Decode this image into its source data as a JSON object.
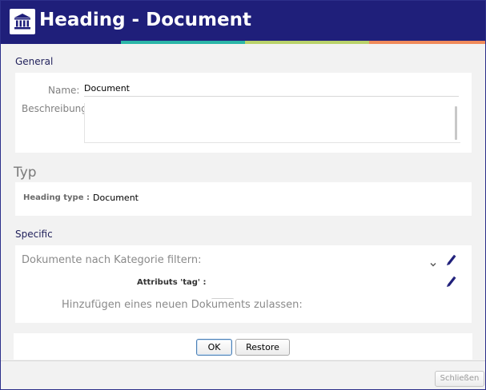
{
  "window": {
    "title": "Heading - Document",
    "icon": "building-columns-icon",
    "colors": {
      "titlebar": "#1f1f7a",
      "accent_stripes": [
        "#1f1f7a",
        "#2bb6a8",
        "#b9d26a",
        "#f08a5a"
      ]
    }
  },
  "general": {
    "section_label": "General",
    "name_label": "Name:",
    "name_value": "Document",
    "description_label": "Beschreibung:",
    "description_value": ""
  },
  "typ": {
    "heading": "Typ",
    "heading_type_label": "Heading type :",
    "heading_type_value": "Document"
  },
  "specific": {
    "section_label": "Specific",
    "filter_label": "Dokumente nach Kategorie filtern:",
    "filter_dropdown_icon": "chevron-down-icon",
    "filter_edit_icon": "pencil-icon",
    "attribute_label": "Attributs 'tag' :",
    "attribute_edit_icon": "pencil-icon",
    "allow_new_label": "Hinzufügen eines neuen Dokuments zulassen:"
  },
  "buttons": {
    "ok": "OK",
    "restore": "Restore",
    "close": "Schließen"
  }
}
